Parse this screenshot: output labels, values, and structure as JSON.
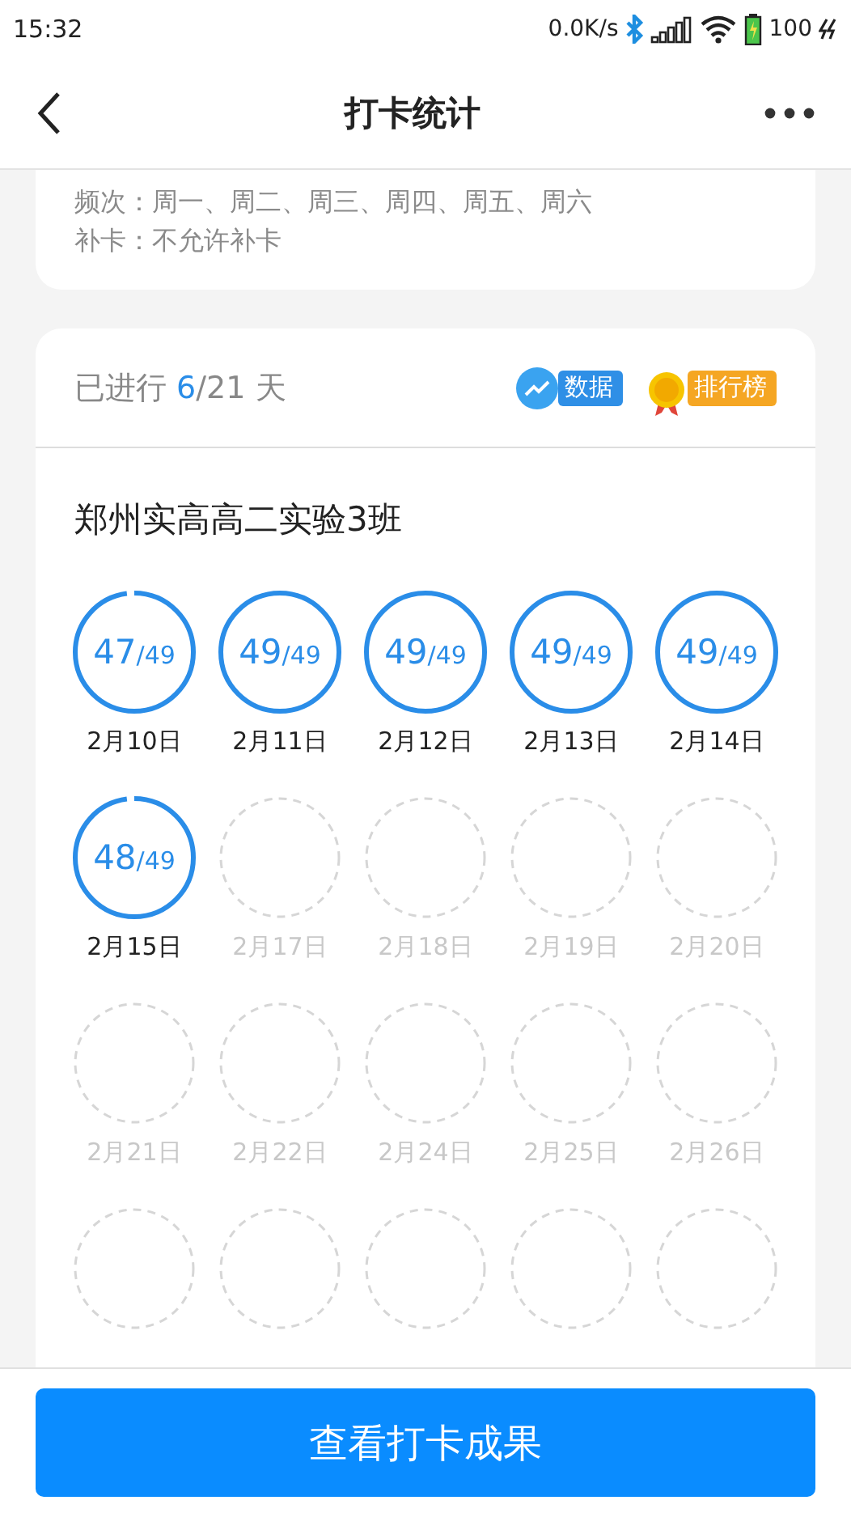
{
  "status_bar": {
    "time": "15:32",
    "speed": "0.0K/s",
    "battery": "100"
  },
  "header": {
    "title": "打卡统计"
  },
  "rules": [
    "频次：周一、周二、周三、周四、周五、周六",
    "补卡：不允许补卡"
  ],
  "progress": {
    "prefix": "已进行 ",
    "done": "6",
    "rest": "/21 天"
  },
  "actions": [
    {
      "kind": "data",
      "label": "数据"
    },
    {
      "kind": "ranking",
      "label": "排行榜"
    }
  ],
  "group": {
    "name": "郑州实高高二实验3班"
  },
  "days": [
    {
      "kind": "done",
      "count": "47",
      "total": "/49",
      "complete": false,
      "date": "2月10日"
    },
    {
      "kind": "done",
      "count": "49",
      "total": "/49",
      "complete": true,
      "date": "2月11日"
    },
    {
      "kind": "done",
      "count": "49",
      "total": "/49",
      "complete": true,
      "date": "2月12日"
    },
    {
      "kind": "done",
      "count": "49",
      "total": "/49",
      "complete": true,
      "date": "2月13日"
    },
    {
      "kind": "done",
      "count": "49",
      "total": "/49",
      "complete": true,
      "date": "2月14日"
    },
    {
      "kind": "done",
      "count": "48",
      "total": "/49",
      "complete": false,
      "date": "2月15日"
    },
    {
      "kind": "pending",
      "date": "2月17日"
    },
    {
      "kind": "pending",
      "date": "2月18日"
    },
    {
      "kind": "pending",
      "date": "2月19日"
    },
    {
      "kind": "pending",
      "date": "2月20日"
    },
    {
      "kind": "pending",
      "date": "2月21日"
    },
    {
      "kind": "pending",
      "date": "2月22日"
    },
    {
      "kind": "pending",
      "date": "2月24日"
    },
    {
      "kind": "pending",
      "date": "2月25日"
    },
    {
      "kind": "pending",
      "date": "2月26日"
    },
    {
      "kind": "pending"
    },
    {
      "kind": "pending"
    },
    {
      "kind": "pending"
    },
    {
      "kind": "pending"
    },
    {
      "kind": "pending"
    }
  ],
  "footer": {
    "button": "查看打卡成果"
  }
}
